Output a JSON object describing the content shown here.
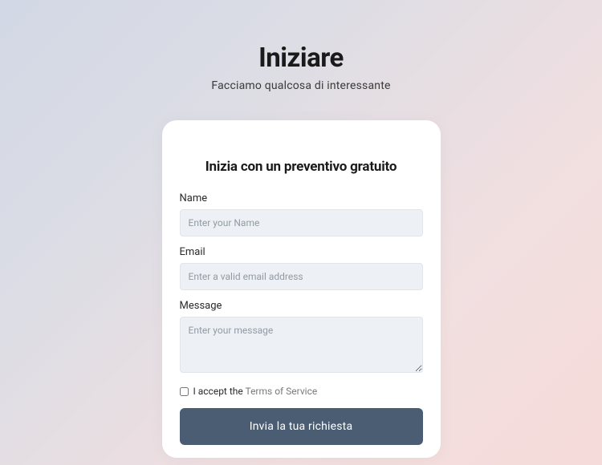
{
  "header": {
    "title": "Iniziare",
    "subtitle": "Facciamo qualcosa di interessante"
  },
  "form": {
    "title": "Inizia con un preventivo gratuito",
    "name": {
      "label": "Name",
      "placeholder": "Enter your Name"
    },
    "email": {
      "label": "Email",
      "placeholder": "Enter a valid email address"
    },
    "message": {
      "label": "Message",
      "placeholder": "Enter your message"
    },
    "terms": {
      "accept_text": "I accept the ",
      "link_text": "Terms of Service"
    },
    "submit_label": "Invia la tua richiesta"
  }
}
